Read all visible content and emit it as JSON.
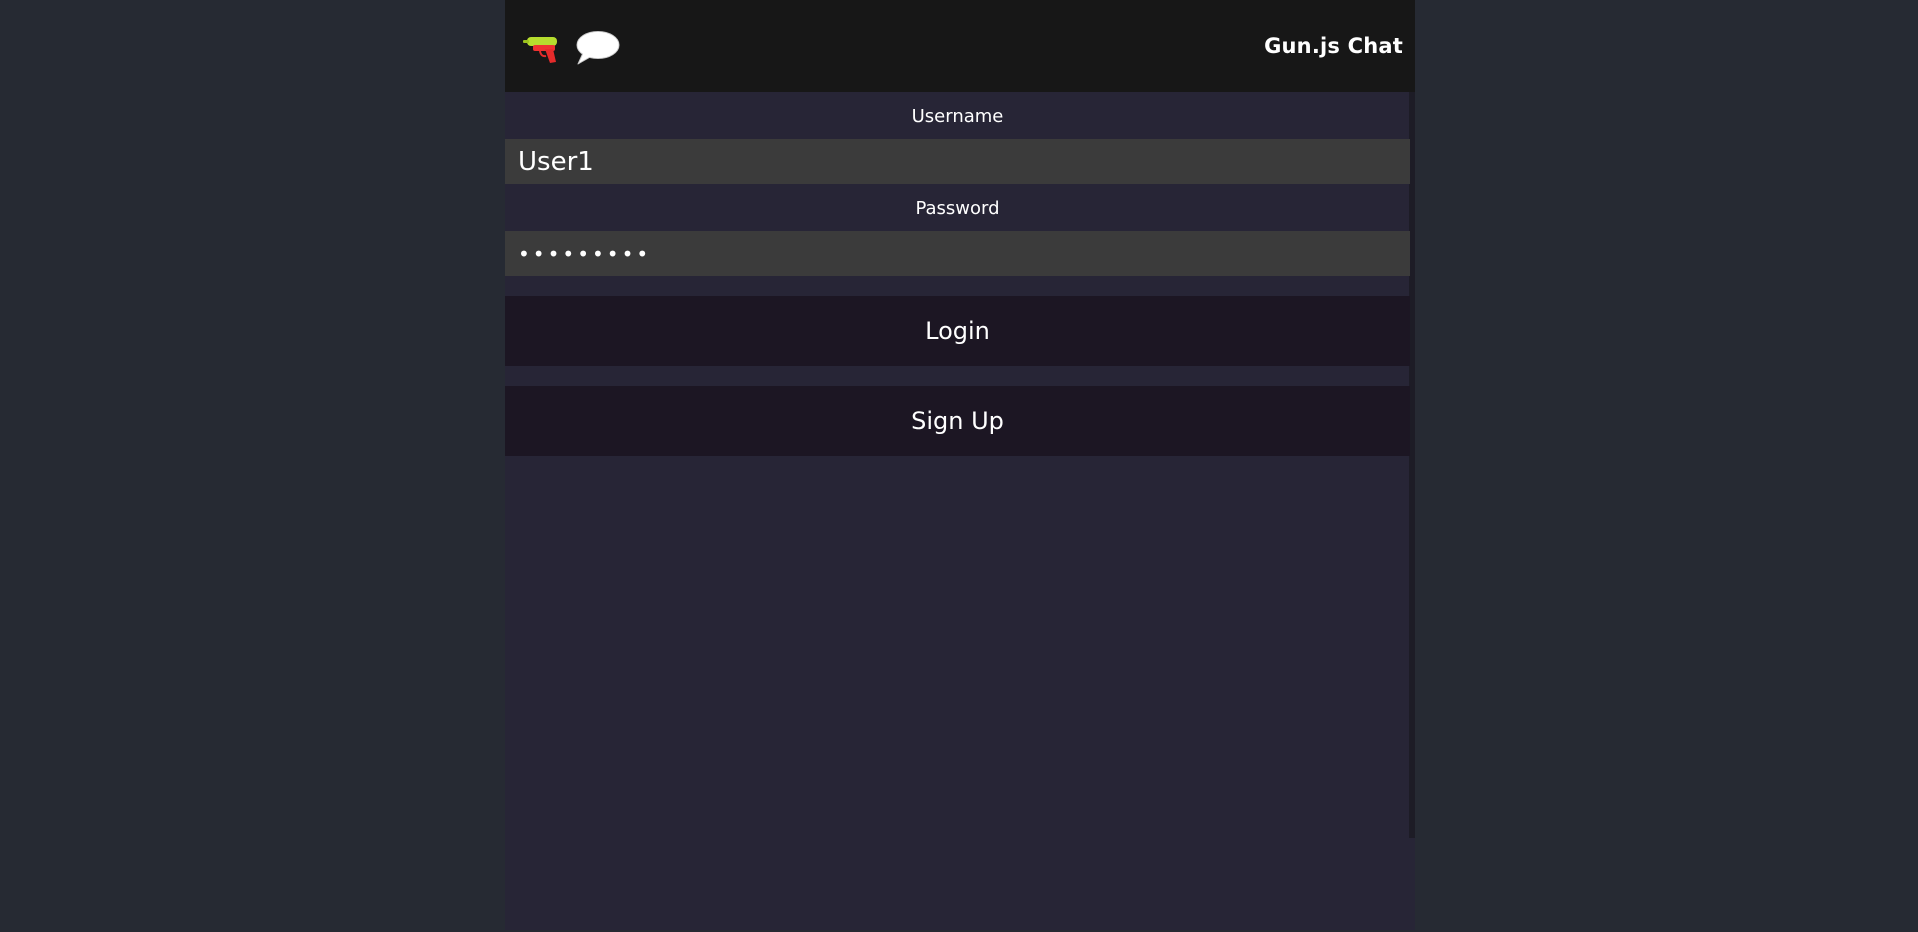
{
  "header": {
    "title": "Gun.js Chat",
    "icons": [
      "water-gun-icon",
      "speech-bubble-icon"
    ]
  },
  "form": {
    "username_label": "Username",
    "username_value": "User1",
    "password_label": "Password",
    "password_value": "•••••••••",
    "login_label": "Login",
    "signup_label": "Sign Up"
  },
  "colors": {
    "page_background": "#262a33",
    "app_background": "#272536",
    "header_background": "#171717",
    "input_background": "#3b3b3b",
    "button_background": "#1c1623",
    "text": "#ffffff"
  }
}
